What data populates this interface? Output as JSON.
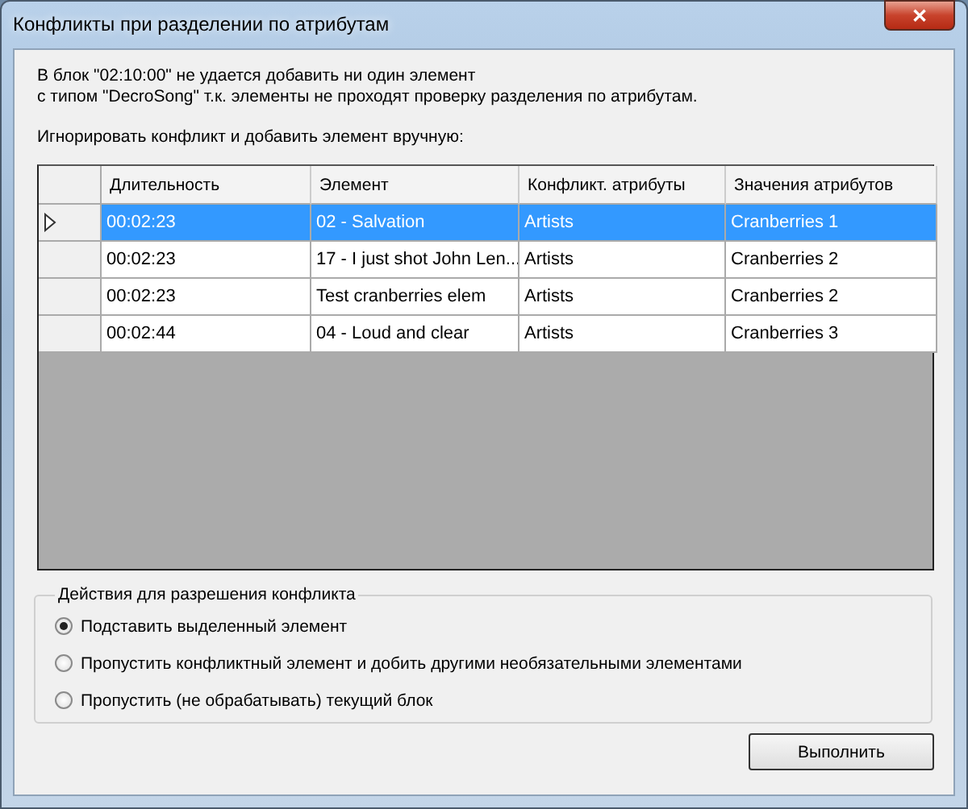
{
  "window": {
    "title": "Конфликты при разделении по атрибутам",
    "close": "✕"
  },
  "message": [
    "В блок \"02:10:00\" не удается добавить ни один элемент",
    "с типом \"DecroSong\" т.к. элементы не проходят проверку разделения по атрибутам."
  ],
  "table_caption": "Игнорировать конфликт и добавить элемент вручную:",
  "table": {
    "columns": [
      "Длительность",
      "Элемент",
      "Конфликт. атрибуты",
      "Значения атрибутов"
    ],
    "rows": [
      {
        "selected": true,
        "cells": [
          "00:02:23",
          "02 - Salvation",
          "Artists",
          "Cranberries 1"
        ]
      },
      {
        "selected": false,
        "cells": [
          "00:02:23",
          "17 - I just shot John Len...",
          "Artists",
          "Cranberries 2"
        ]
      },
      {
        "selected": false,
        "cells": [
          "00:02:23",
          "Test cranberries elem",
          "Artists",
          "Cranberries 2"
        ]
      },
      {
        "selected": false,
        "cells": [
          "00:02:44",
          "04 - Loud and clear",
          "Artists",
          "Cranberries 3"
        ]
      }
    ]
  },
  "actions": {
    "title": "Действия для разрешения конфликта",
    "options": [
      {
        "label": "Подставить выделенный элемент",
        "selected": true
      },
      {
        "label": "Пропустить конфликтный элемент и добить другими необязательными элементами",
        "selected": false
      },
      {
        "label": "Пропустить (не обрабатывать) текущий блок",
        "selected": false
      }
    ]
  },
  "buttons": [
    "Выполнить"
  ]
}
